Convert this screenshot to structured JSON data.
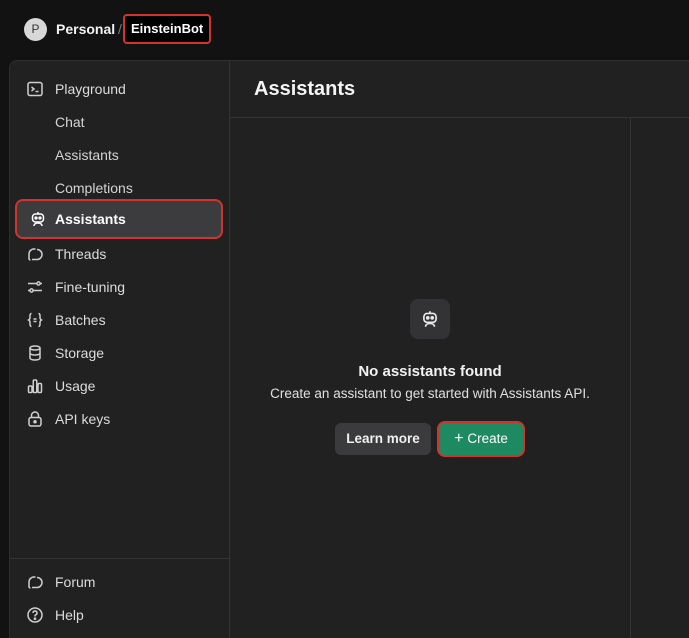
{
  "header": {
    "avatar_letter": "P",
    "org_name": "Personal",
    "separator": "/",
    "project_name": "EinsteinBot"
  },
  "sidebar": {
    "playground": "Playground",
    "sub_items": [
      "Chat",
      "Assistants",
      "Completions"
    ],
    "active_item": "Assistants",
    "items": [
      {
        "label": "Threads",
        "icon": "threads-icon"
      },
      {
        "label": "Fine-tuning",
        "icon": "sliders-icon"
      },
      {
        "label": "Batches",
        "icon": "braces-icon"
      },
      {
        "label": "Storage",
        "icon": "database-icon"
      },
      {
        "label": "Usage",
        "icon": "bar-chart-icon"
      },
      {
        "label": "API keys",
        "icon": "lock-icon"
      }
    ],
    "bottom": [
      {
        "label": "Forum",
        "icon": "forum-icon"
      },
      {
        "label": "Help",
        "icon": "help-icon"
      }
    ]
  },
  "main": {
    "title": "Assistants",
    "empty_title": "No assistants found",
    "empty_description": "Create an assistant to get started with Assistants API.",
    "learn_more_label": "Learn more",
    "create_label": "Create",
    "create_icon": "+"
  },
  "colors": {
    "accent_green": "#1e8a62",
    "highlight_red": "#d0342c"
  }
}
